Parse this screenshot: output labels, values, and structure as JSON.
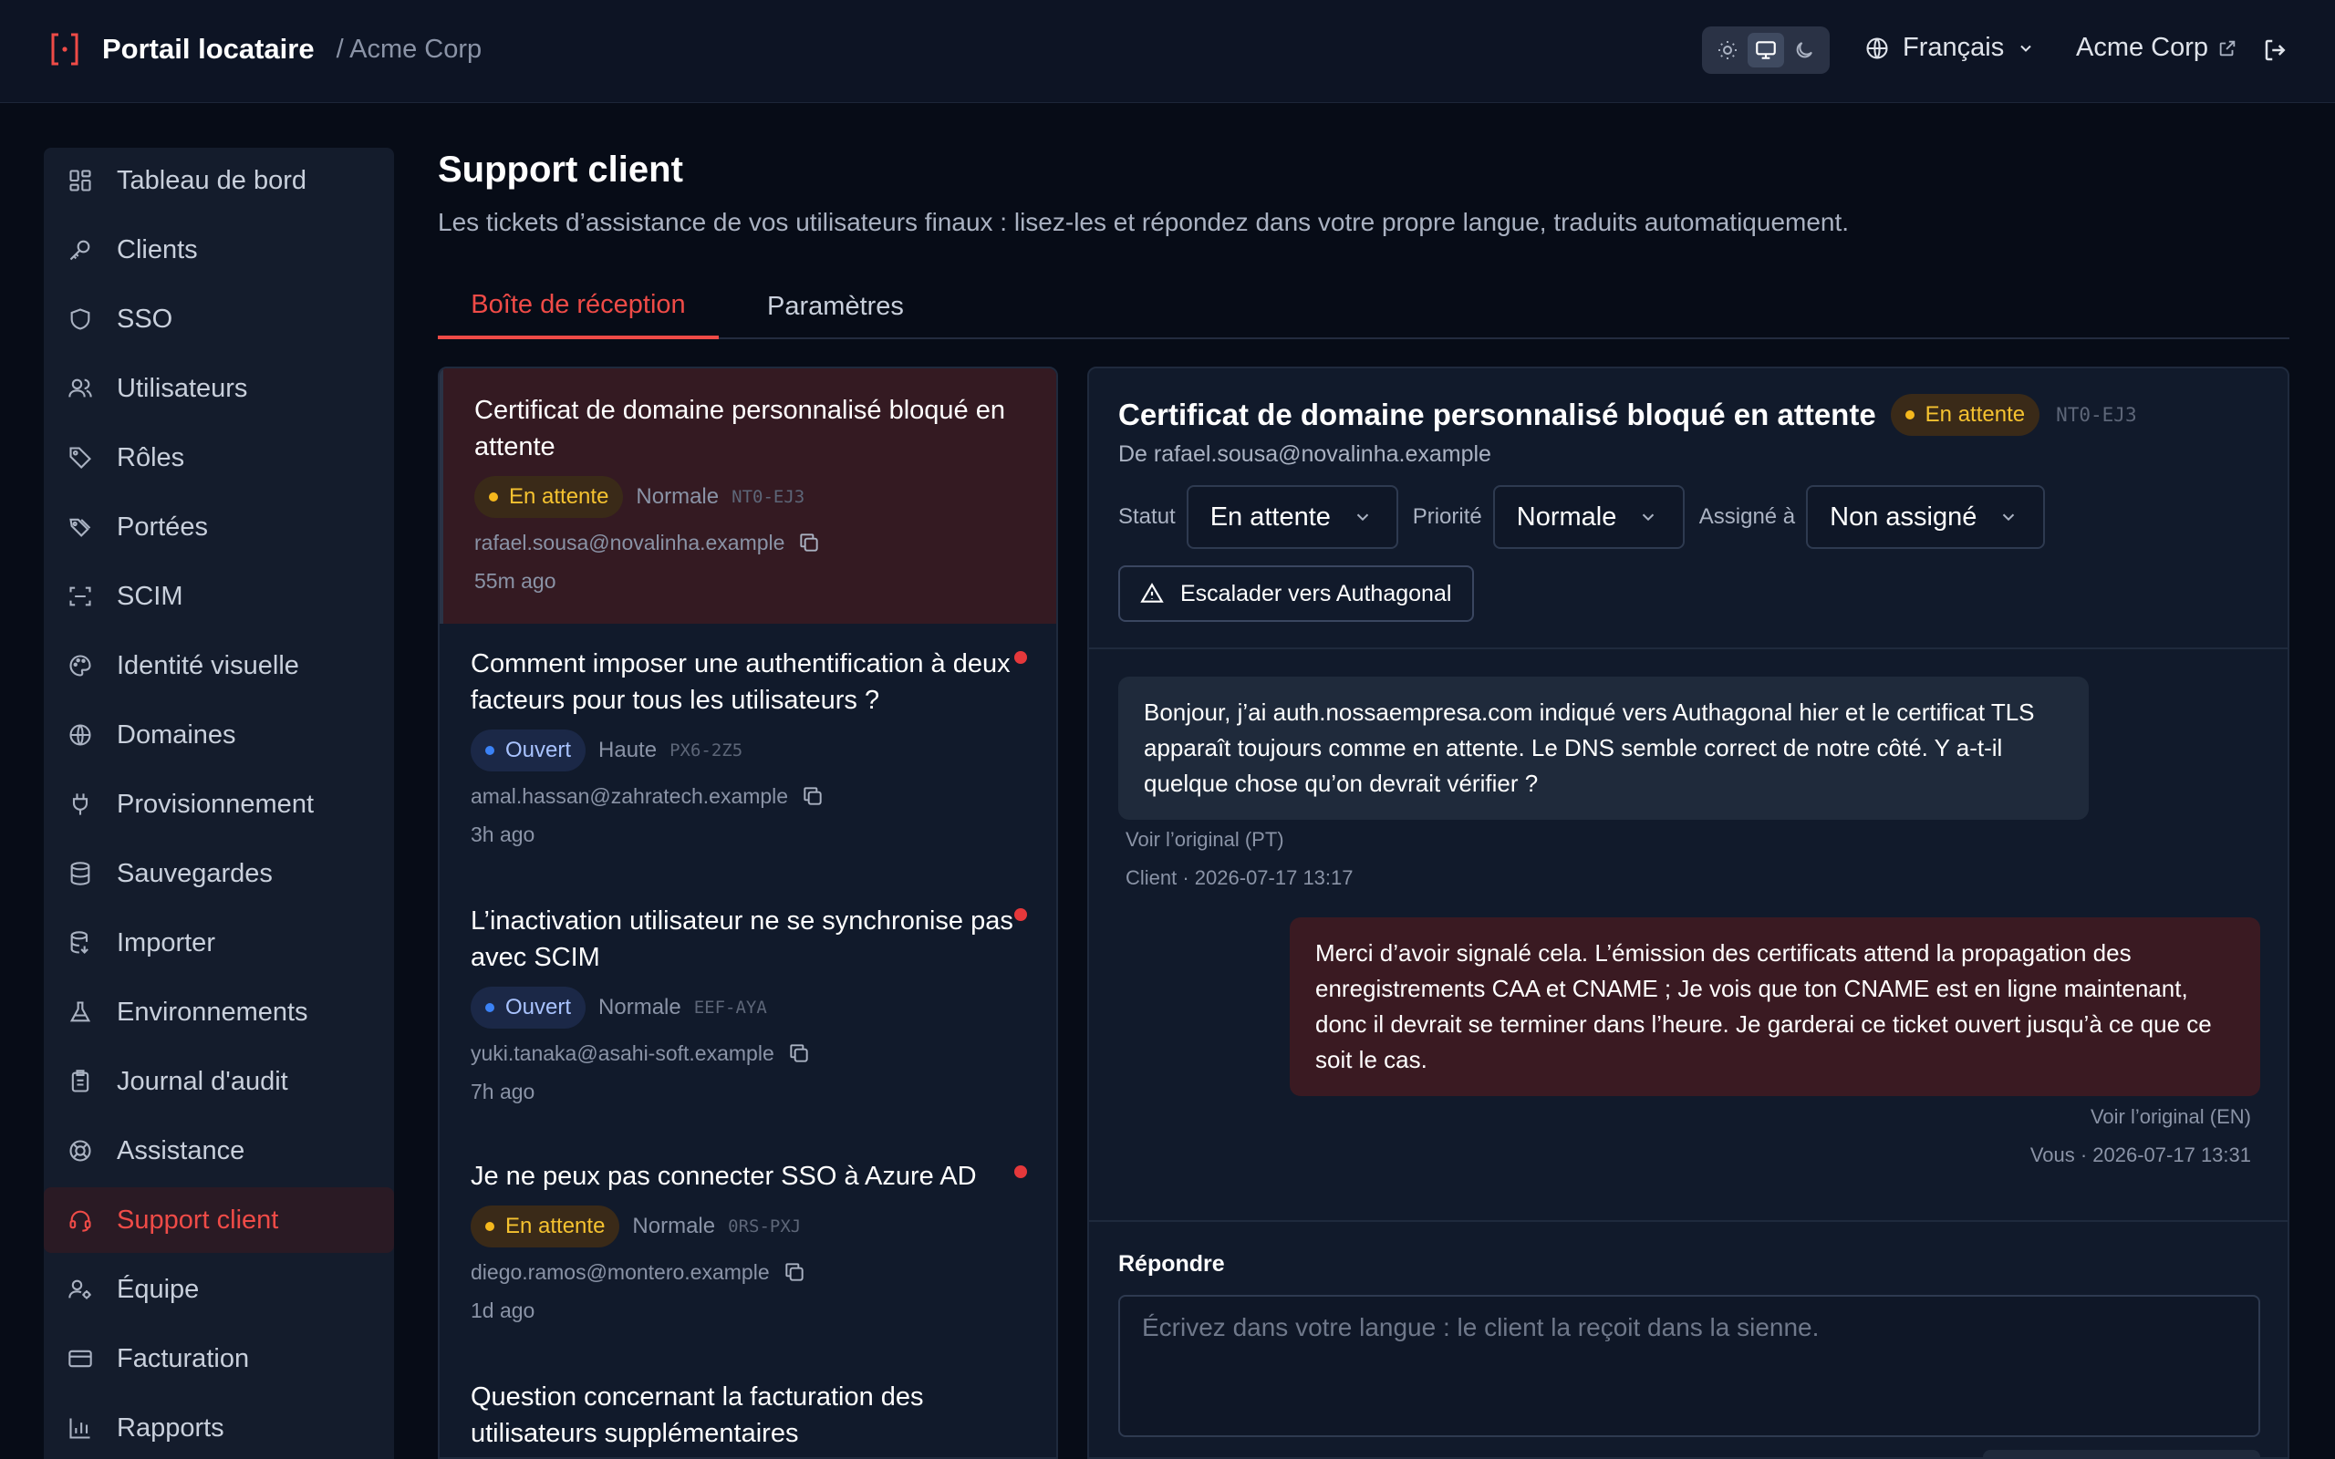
{
  "header": {
    "app_title": "Portail locataire",
    "tenant_crumb": "/ Acme Corp",
    "language": "Français",
    "org_name": "Acme Corp"
  },
  "sidebar": {
    "items": [
      {
        "label": "Tableau de bord",
        "icon": "dashboard-icon"
      },
      {
        "label": "Clients",
        "icon": "key-icon"
      },
      {
        "label": "SSO",
        "icon": "shield-icon"
      },
      {
        "label": "Utilisateurs",
        "icon": "users-icon"
      },
      {
        "label": "Rôles",
        "icon": "tag-icon"
      },
      {
        "label": "Portées",
        "icon": "tags-icon"
      },
      {
        "label": "SCIM",
        "icon": "scan-icon"
      },
      {
        "label": "Identité visuelle",
        "icon": "palette-icon"
      },
      {
        "label": "Domaines",
        "icon": "globe-icon"
      },
      {
        "label": "Provisionnement",
        "icon": "plug-icon"
      },
      {
        "label": "Sauvegardes",
        "icon": "database-icon"
      },
      {
        "label": "Importer",
        "icon": "database-import-icon"
      },
      {
        "label": "Environnements",
        "icon": "flask-icon"
      },
      {
        "label": "Journal d'audit",
        "icon": "clipboard-icon"
      },
      {
        "label": "Assistance",
        "icon": "lifebuoy-icon"
      },
      {
        "label": "Support client",
        "icon": "headset-icon",
        "active": true
      },
      {
        "label": "Équipe",
        "icon": "user-cog-icon"
      },
      {
        "label": "Facturation",
        "icon": "credit-card-icon"
      },
      {
        "label": "Rapports",
        "icon": "bar-chart-icon"
      }
    ]
  },
  "page": {
    "title": "Support client",
    "description": "Les tickets d’assistance de vos utilisateurs finaux : lisez-les et répondez dans votre propre langue, traduits automatiquement.",
    "tabs": [
      "Boîte de réception",
      "Paramètres"
    ]
  },
  "tickets": [
    {
      "title": "Certificat de domaine personnalisé bloqué en attente",
      "status": "En attente",
      "priority": "Normale",
      "id": "NT0-EJ3",
      "email": "rafael.sousa@novalinha.example",
      "time": "55m ago",
      "unread": false
    },
    {
      "title": "Comment imposer une authentification à deux facteurs pour tous les utilisateurs ?",
      "status": "Ouvert",
      "priority": "Haute",
      "id": "PX6-2Z5",
      "email": "amal.hassan@zahratech.example",
      "time": "3h ago",
      "unread": true
    },
    {
      "title": "L’inactivation utilisateur ne se synchronise pas avec SCIM",
      "status": "Ouvert",
      "priority": "Normale",
      "id": "EEF-AYA",
      "email": "yuki.tanaka@asahi-soft.example",
      "time": "7h ago",
      "unread": true
    },
    {
      "title": "Je ne peux pas connecter SSO à Azure AD",
      "status": "En attente",
      "priority": "Normale",
      "id": "0RS-PXJ",
      "email": "diego.ramos@montero.example",
      "time": "1d ago",
      "unread": true
    },
    {
      "title": "Question concernant la facturation des utilisateurs supplémentaires",
      "status": "",
      "priority": "",
      "id": "",
      "email": "",
      "time": "",
      "unread": false
    }
  ],
  "detail": {
    "title": "Certificat de domaine personnalisé bloqué en attente",
    "status": "En attente",
    "id": "NT0-EJ3",
    "from": "De rafael.sousa@novalinha.example",
    "status_label": "Statut",
    "status_value": "En attente",
    "priority_label": "Priorité",
    "priority_value": "Normale",
    "assignee_label": "Assigné à",
    "assignee_value": "Non assigné",
    "escalate_label": "Escalader vers Authagonal",
    "messages": [
      {
        "text": "Bonjour, j’ai auth.nossaempresa.com indiqué vers Authagonal hier et le certificat TLS apparaît toujours comme en attente. Le DNS semble correct de notre côté. Y a-t-il quelque chose qu’on devrait vérifier ?",
        "original": "Voir l’original (PT)",
        "meta": "Client · 2026-07-17 13:17"
      },
      {
        "text": "Merci d’avoir signalé cela. L’émission des certificats attend la propagation des enregistrements CAA et CNAME ; Je vois que ton CNAME est en ligne maintenant, donc il devrait se terminer dans l’heure. Je garderai ce ticket ouvert jusqu’à ce que ce soit le cas.",
        "original": "Voir l’original (EN)",
        "meta": "Vous · 2026-07-17 13:31"
      }
    ],
    "reply_label": "Répondre",
    "reply_placeholder": "Écrivez dans votre langue : le client la reçoit dans la sienne."
  },
  "colors": {
    "accent": "#ef4b47",
    "pending": "#f5b81d",
    "open": "#3b82f6"
  }
}
